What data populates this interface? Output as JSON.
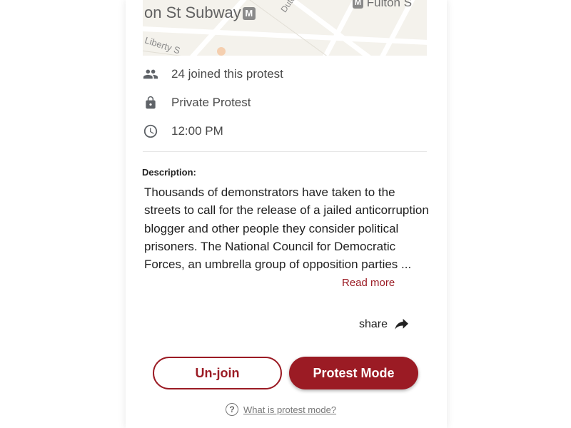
{
  "map": {
    "label_station": "on St Subway",
    "label_station_badge": "M",
    "label_fulton": "Fulton S",
    "label_fulton_badge": "M",
    "label_dutch": "Dutch",
    "label_liberty": "Liberty S",
    "background_color": "#f4f2ec"
  },
  "details": {
    "joined": "24 joined this protest",
    "privacy": "Private Protest",
    "time": "12:00 PM",
    "icons": {
      "joined": "people-icon",
      "privacy": "lock-icon",
      "time": "clock-icon"
    }
  },
  "description": {
    "label": "Description:",
    "text": "Thousands of demonstrators have taken to the streets to call for the release of a jailed anticorruption blogger and other people they consider political prisoners. The National Council for Democratic Forces, an umbrella group of opposition parties ...",
    "read_more": "Read more"
  },
  "share": {
    "label": "share",
    "icon": "share-arrow-icon"
  },
  "actions": {
    "unjoin_label": "Un-join",
    "protest_mode_label": "Protest Mode"
  },
  "help": {
    "link_text": "What is protest mode?",
    "icon_glyph": "?",
    "icon": "question-circle-icon"
  },
  "colors": {
    "accent": "#9b1b24",
    "text": "#1f1f1f",
    "muted": "#4a4a4a"
  }
}
